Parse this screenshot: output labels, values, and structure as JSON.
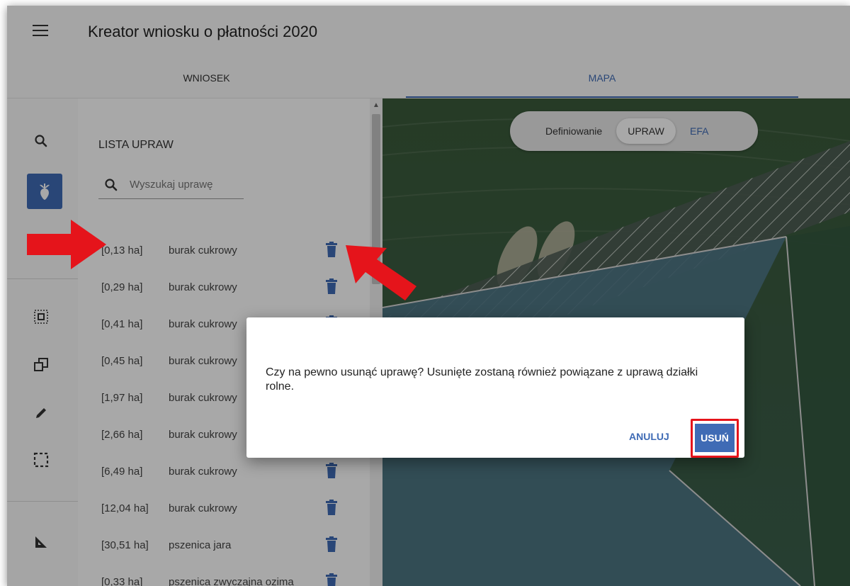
{
  "header": {
    "title": "Kreator wniosku o płatności 2020"
  },
  "tabs": [
    {
      "label": "WNIOSEK",
      "active": false
    },
    {
      "label": "MAPA",
      "active": true
    }
  ],
  "toolbar": {
    "tools": [
      "search-icon",
      "beet-icon",
      "list-icon",
      "select-area-icon",
      "copy-polygon-icon",
      "pencil-icon",
      "dashed-rectangle-icon",
      "ruler-triangle-icon"
    ],
    "active_tool": "beet-icon"
  },
  "panel": {
    "title": "LISTA UPRAW",
    "search_placeholder": "Wyszukaj uprawę",
    "crops": [
      {
        "area": "[0,13 ha]",
        "name": "burak cukrowy"
      },
      {
        "area": "[0,29 ha]",
        "name": "burak cukrowy"
      },
      {
        "area": "[0,41 ha]",
        "name": "burak cukrowy"
      },
      {
        "area": "[0,45 ha]",
        "name": "burak cukrowy"
      },
      {
        "area": "[1,97 ha]",
        "name": "burak cukrowy"
      },
      {
        "area": "[2,66 ha]",
        "name": "burak cukrowy"
      },
      {
        "area": "[6,49 ha]",
        "name": "burak cukrowy"
      },
      {
        "area": "[12,04 ha]",
        "name": "burak cukrowy"
      },
      {
        "area": "[30,51 ha]",
        "name": "pszenica jara"
      },
      {
        "area": "[0,33 ha]",
        "name": "pszenica zwyczajna ozima"
      }
    ]
  },
  "map_toggle": {
    "label": "Definiowanie",
    "option_selected": "UPRAW",
    "option_other": "EFA"
  },
  "dialog": {
    "message": "Czy na pewno usunąć uprawę? Usunięte zostaną również powiązane z uprawą działki rolne.",
    "cancel_label": "ANULUJ",
    "delete_label": "USUŃ"
  },
  "colors": {
    "accent": "#3f6bb5",
    "annotation_red": "#e5141b"
  }
}
